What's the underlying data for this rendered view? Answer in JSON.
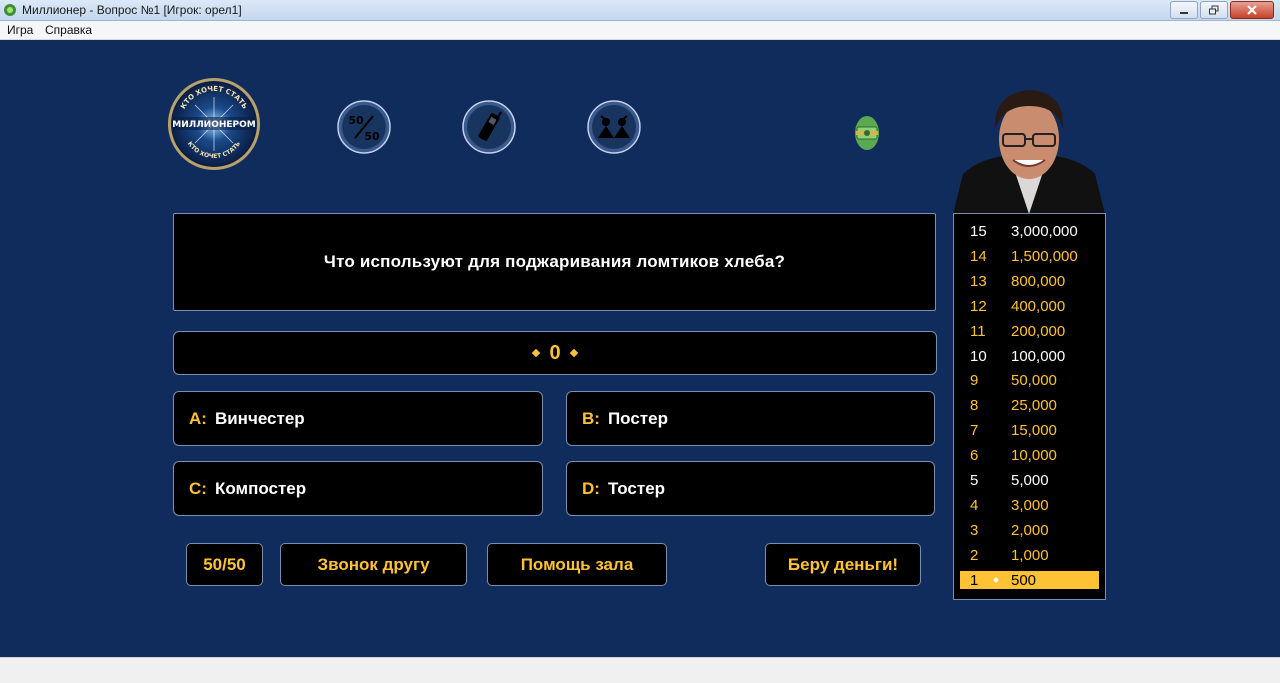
{
  "window": {
    "title": "Миллионер - Вопрос №1 [Игрок: орел1]"
  },
  "menu": {
    "items": [
      "Игра",
      "Справка"
    ]
  },
  "logo": {
    "top_text": "КТО ХОЧЕТ СТАТЬ",
    "main_text": "МИЛЛИОНЕРОМ",
    "bottom_text": "КТО ХОЧЕТ СТАТЬ"
  },
  "lifeline_icons": {
    "fifty_top": "50",
    "fifty_bottom": "50"
  },
  "question": {
    "text": "Что используют для поджаривания ломтиков хлеба?"
  },
  "score": {
    "value": "0"
  },
  "answers": [
    {
      "letter": "A:",
      "text": "Винчестер"
    },
    {
      "letter": "B:",
      "text": "Постер"
    },
    {
      "letter": "C:",
      "text": "Компостер"
    },
    {
      "letter": "D:",
      "text": "Тостер"
    }
  ],
  "buttons": {
    "fifty": "50/50",
    "call_friend": "Звонок другу",
    "audience": "Помощь зала",
    "take_money": "Беру деньги!"
  },
  "ladder": [
    {
      "level": "15",
      "amount": "3,000,000",
      "milestone": true
    },
    {
      "level": "14",
      "amount": "1,500,000",
      "milestone": false
    },
    {
      "level": "13",
      "amount": "800,000",
      "milestone": false
    },
    {
      "level": "12",
      "amount": "400,000",
      "milestone": false
    },
    {
      "level": "11",
      "amount": "200,000",
      "milestone": false
    },
    {
      "level": "10",
      "amount": "100,000",
      "milestone": true
    },
    {
      "level": "9",
      "amount": "50,000",
      "milestone": false
    },
    {
      "level": "8",
      "amount": "25,000",
      "milestone": false
    },
    {
      "level": "7",
      "amount": "15,000",
      "milestone": false
    },
    {
      "level": "6",
      "amount": "10,000",
      "milestone": false
    },
    {
      "level": "5",
      "amount": "5,000",
      "milestone": true
    },
    {
      "level": "4",
      "amount": "3,000",
      "milestone": false
    },
    {
      "level": "3",
      "amount": "2,000",
      "milestone": false
    },
    {
      "level": "2",
      "amount": "1,000",
      "milestone": false
    },
    {
      "level": "1",
      "amount": "500",
      "milestone": false,
      "current": true
    }
  ],
  "colors": {
    "background": "#0f2c5c",
    "accent": "#ffc235",
    "milestone": "#ffffff",
    "border": "#7b8db0"
  }
}
